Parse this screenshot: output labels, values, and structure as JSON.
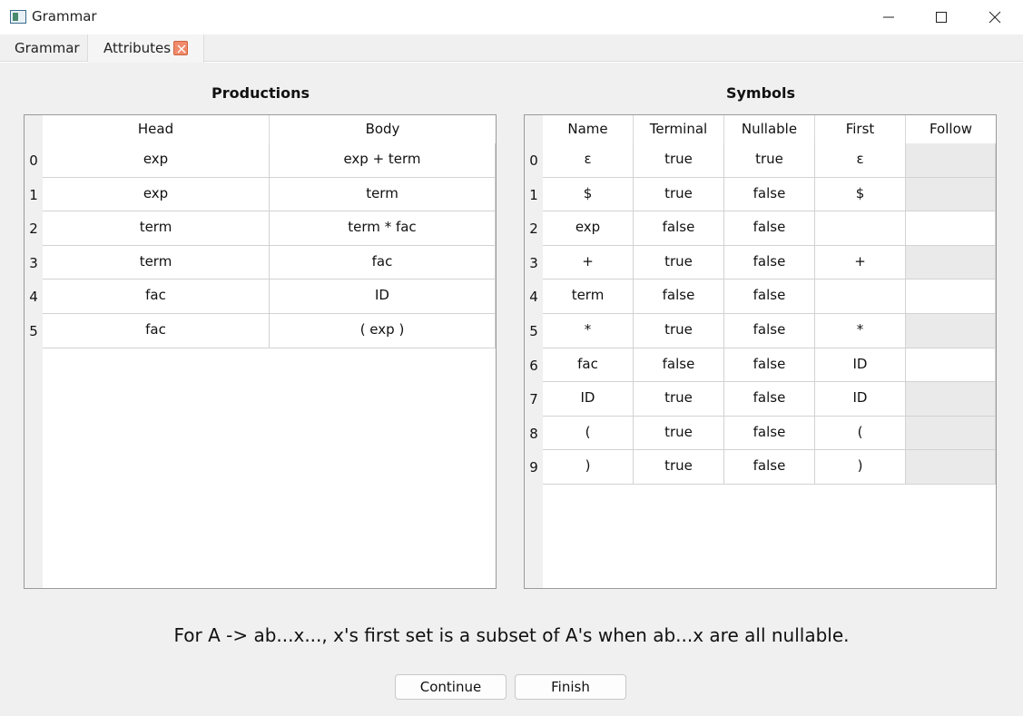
{
  "window": {
    "title": "Grammar"
  },
  "tabs": [
    {
      "label": "Grammar"
    },
    {
      "label": "Attributes"
    }
  ],
  "productions": {
    "title": "Productions",
    "columns": [
      "Head",
      "Body"
    ],
    "rows": [
      {
        "index": "0",
        "head": "exp",
        "body": "exp + term"
      },
      {
        "index": "1",
        "head": "exp",
        "body": "term"
      },
      {
        "index": "2",
        "head": "term",
        "body": "term * fac"
      },
      {
        "index": "3",
        "head": "term",
        "body": "fac"
      },
      {
        "index": "4",
        "head": "fac",
        "body": "ID"
      },
      {
        "index": "5",
        "head": "fac",
        "body": "( exp )"
      }
    ]
  },
  "symbols": {
    "title": "Symbols",
    "columns": [
      "Name",
      "Terminal",
      "Nullable",
      "First",
      "Follow"
    ],
    "rows": [
      {
        "index": "0",
        "name": "ε",
        "terminal": "true",
        "nullable": "true",
        "first": "ε",
        "follow": ""
      },
      {
        "index": "1",
        "name": "$",
        "terminal": "true",
        "nullable": "false",
        "first": "$",
        "follow": ""
      },
      {
        "index": "2",
        "name": "exp",
        "terminal": "false",
        "nullable": "false",
        "first": "",
        "follow": ""
      },
      {
        "index": "3",
        "name": "+",
        "terminal": "true",
        "nullable": "false",
        "first": "+",
        "follow": ""
      },
      {
        "index": "4",
        "name": "term",
        "terminal": "false",
        "nullable": "false",
        "first": "",
        "follow": ""
      },
      {
        "index": "5",
        "name": "*",
        "terminal": "true",
        "nullable": "false",
        "first": "*",
        "follow": ""
      },
      {
        "index": "6",
        "name": "fac",
        "terminal": "false",
        "nullable": "false",
        "first": "ID",
        "follow": ""
      },
      {
        "index": "7",
        "name": "ID",
        "terminal": "true",
        "nullable": "false",
        "first": "ID",
        "follow": ""
      },
      {
        "index": "8",
        "name": "(",
        "terminal": "true",
        "nullable": "false",
        "first": "(",
        "follow": ""
      },
      {
        "index": "9",
        "name": ")",
        "terminal": "true",
        "nullable": "false",
        "first": ")",
        "follow": ""
      }
    ]
  },
  "hint": "For A -> ab...x..., x's first set is a subset of A's when ab...x are all nullable.",
  "buttons": {
    "continue": "Continue",
    "finish": "Finish"
  },
  "colors": {
    "follow_shaded": "#eaeaea",
    "tab_close": "#f08a6a"
  }
}
